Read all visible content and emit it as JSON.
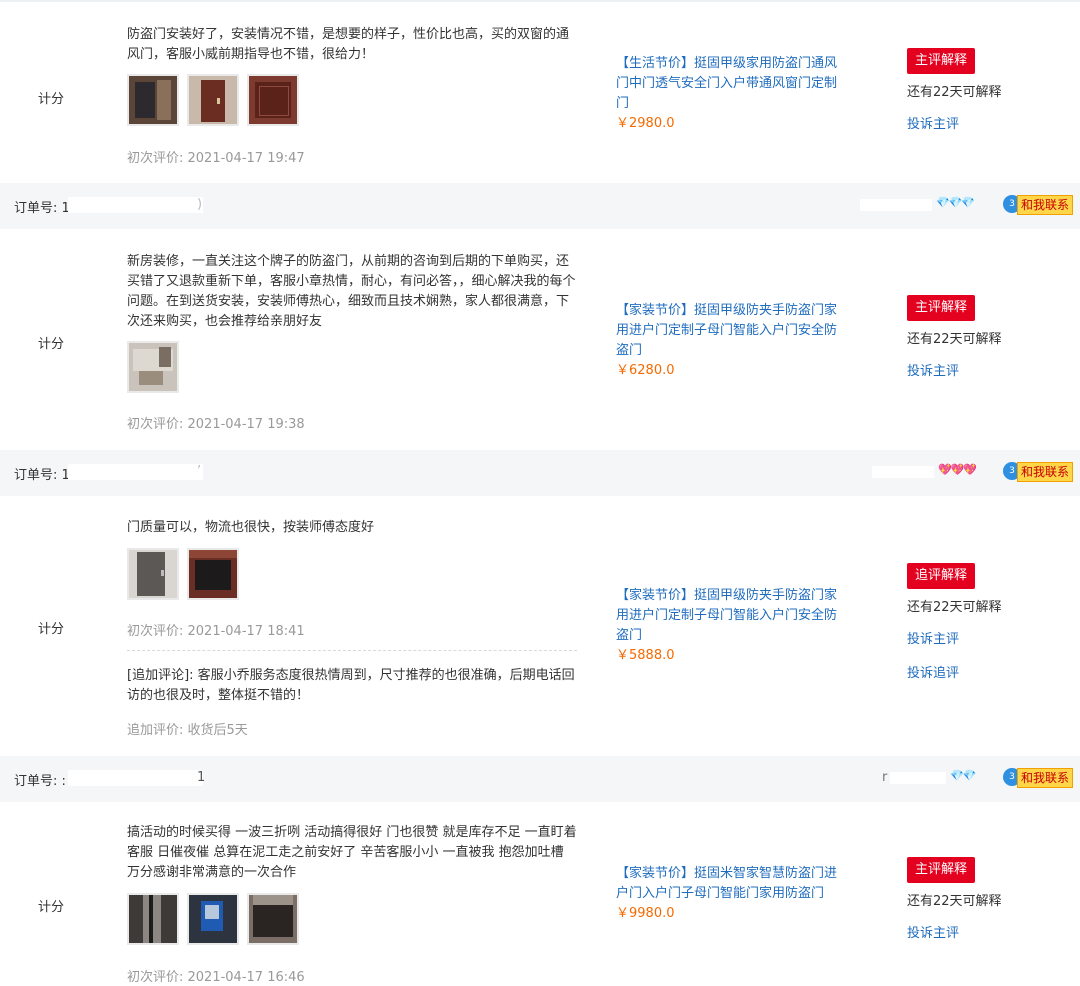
{
  "reviews": [
    {
      "score": "计分",
      "text": "防盗门安装好了，安装情况不错，是想要的样子，性价比也高，买的双窗的通风门，客服小威前期指导也不错，很给力！",
      "date": "初次评价: 2021-04-17 19:47",
      "product_title": "【生活节价】挺固甲级家用防盗门通风门中门透气安全门入户带通风窗门定制门",
      "price": "￥2980.0",
      "reply_button": "主评解释",
      "days_left": "还有22天可解释",
      "complain": "投诉主评"
    },
    {
      "score": "计分",
      "text": "新房装修，一直关注这个牌子的防盗门，从前期的咨询到后期的下单购买，还买错了又退款重新下单，客服小章热情，耐心，有问必答，，细心解决我的每个问题。在到送货安装，安装师傅热心，细致而且技术娴熟，家人都很满意，下次还来购买，也会推荐给亲朋好友",
      "date": "初次评价: 2021-04-17 19:38",
      "product_title": "【家装节价】挺固甲级防夹手防盗门家用进户门定制子母门智能入户门安全防盗门",
      "price": "￥6280.0",
      "reply_button": "主评解释",
      "days_left": "还有22天可解释",
      "complain": "投诉主评"
    },
    {
      "score": "计分",
      "text": "门质量可以，物流也很快，按装师傅态度好",
      "date": "初次评价: 2021-04-17 18:41",
      "followup_text": "[追加评论]: 客服小乔服务态度很热情周到，尺寸推荐的也很准确，后期电话回访的也很及时，整体挺不错的！",
      "followup_date": "追加评价: 收货后5天",
      "product_title": "【家装节价】挺固甲级防夹手防盗门家用进户门定制子母门智能入户门安全防盗门",
      "price": "￥5888.0",
      "reply_button": "追评解释",
      "days_left": "还有22天可解释",
      "complain": "投诉主评",
      "complain_followup": "投诉追评"
    },
    {
      "score": "计分",
      "text": "搞活动的时候买得 一波三折咧 活动搞得很好 门也很赞 就是库存不足 一直盯着客服 日催夜催 总算在泥工走之前安好了 辛苦客服小小 一直被我 抱怨加吐槽 万分感谢非常满意的一次合作",
      "date": "初次评价: 2021-04-17 16:46",
      "product_title": "【家装节价】挺固米智家智慧防盗门进户门入户门子母门智能门家用防盗门",
      "price": "￥9980.0",
      "reply_button": "主评解释",
      "days_left": "还有22天可解释",
      "complain": "投诉主评"
    }
  ],
  "orders": [
    {
      "label": "订单号: 1",
      "tail": ")",
      "gems": "💎💎💎",
      "gem_color": "#f08a00"
    },
    {
      "label": "订单号: 1",
      "tail": "’",
      "gems": "💖💖💖",
      "gem_color": "#e8344e"
    },
    {
      "label": "订单号: :",
      "tail": "1",
      "buyer_initial": "r",
      "gems": "💎💎",
      "gem_color": "#f08a00"
    }
  ],
  "contact": {
    "label": "和我联系",
    "badge": "3"
  },
  "colors": {
    "link": "#1f6cbf",
    "price": "#f56a00",
    "button": "#e4001f",
    "order_bar": "#f5f6f7"
  }
}
